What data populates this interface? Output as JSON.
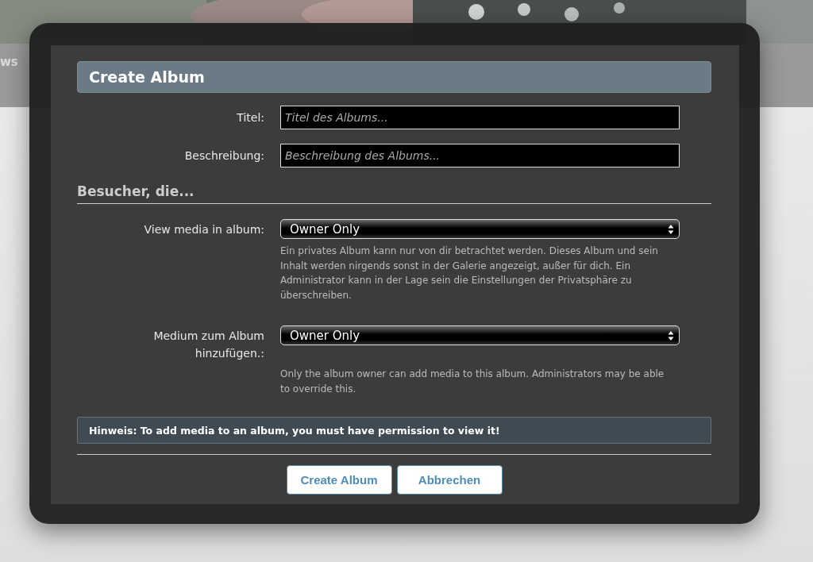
{
  "background": {
    "nav_items": [
      "ws"
    ]
  },
  "dialog": {
    "title": "Create Album",
    "fields": [
      {
        "label": "Titel:",
        "placeholder": "Titel des Albums..."
      },
      {
        "label": "Beschreibung:",
        "placeholder": "Beschreibung des Albums..."
      }
    ],
    "section_heading": "Besucher, die...",
    "permissions": [
      {
        "label": "View media in album:",
        "value": "Owner Only",
        "help": "Ein privates Album kann nur von dir betrachtet werden. Dieses Album und sein Inhalt werden nirgends sonst in der Galerie angezeigt, außer für dich. Ein Administrator kann in der Lage sein die Einstellungen der Privatsphäre zu überschreiben."
      },
      {
        "label": "Medium zum Album hinzufügen.:",
        "value": "Owner Only",
        "help": "Only the album owner can add media to this album. Administrators may be able to override this."
      }
    ],
    "notice": "Hinweis: To add media to an album, you must have permission to view it!",
    "buttons": [
      "Create Album",
      "Abbrechen"
    ]
  }
}
